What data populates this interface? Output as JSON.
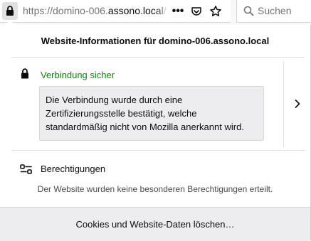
{
  "urlbar": {
    "url_prefix": "https://domino-006.",
    "url_host": "assono.local",
    "url_suffix": "/",
    "actions": [
      "page-actions-menu-icon",
      "pocket-icon",
      "bookmark-star-icon"
    ]
  },
  "search": {
    "placeholder": "Suchen"
  },
  "panel": {
    "header": "Website-Informationen für domino-006.assono.local",
    "security": {
      "status": "Verbindung sicher",
      "description": "Die Verbindung wurde durch eine Zertifizierungsstelle bestätigt, welche standardmäßig nicht von Mozilla anerkannt wird."
    },
    "permissions": {
      "title": "Berechtigungen",
      "description": "Der Website wurden keine besonderen Berechtigungen erteilt."
    },
    "footer_button": "Cookies und Website-Daten löschen…"
  },
  "colors": {
    "secure_green": "#058b00",
    "panel_bg": "#ffffff",
    "footer_bg": "#ededf0",
    "desc_box_bg": "#ededf0"
  }
}
